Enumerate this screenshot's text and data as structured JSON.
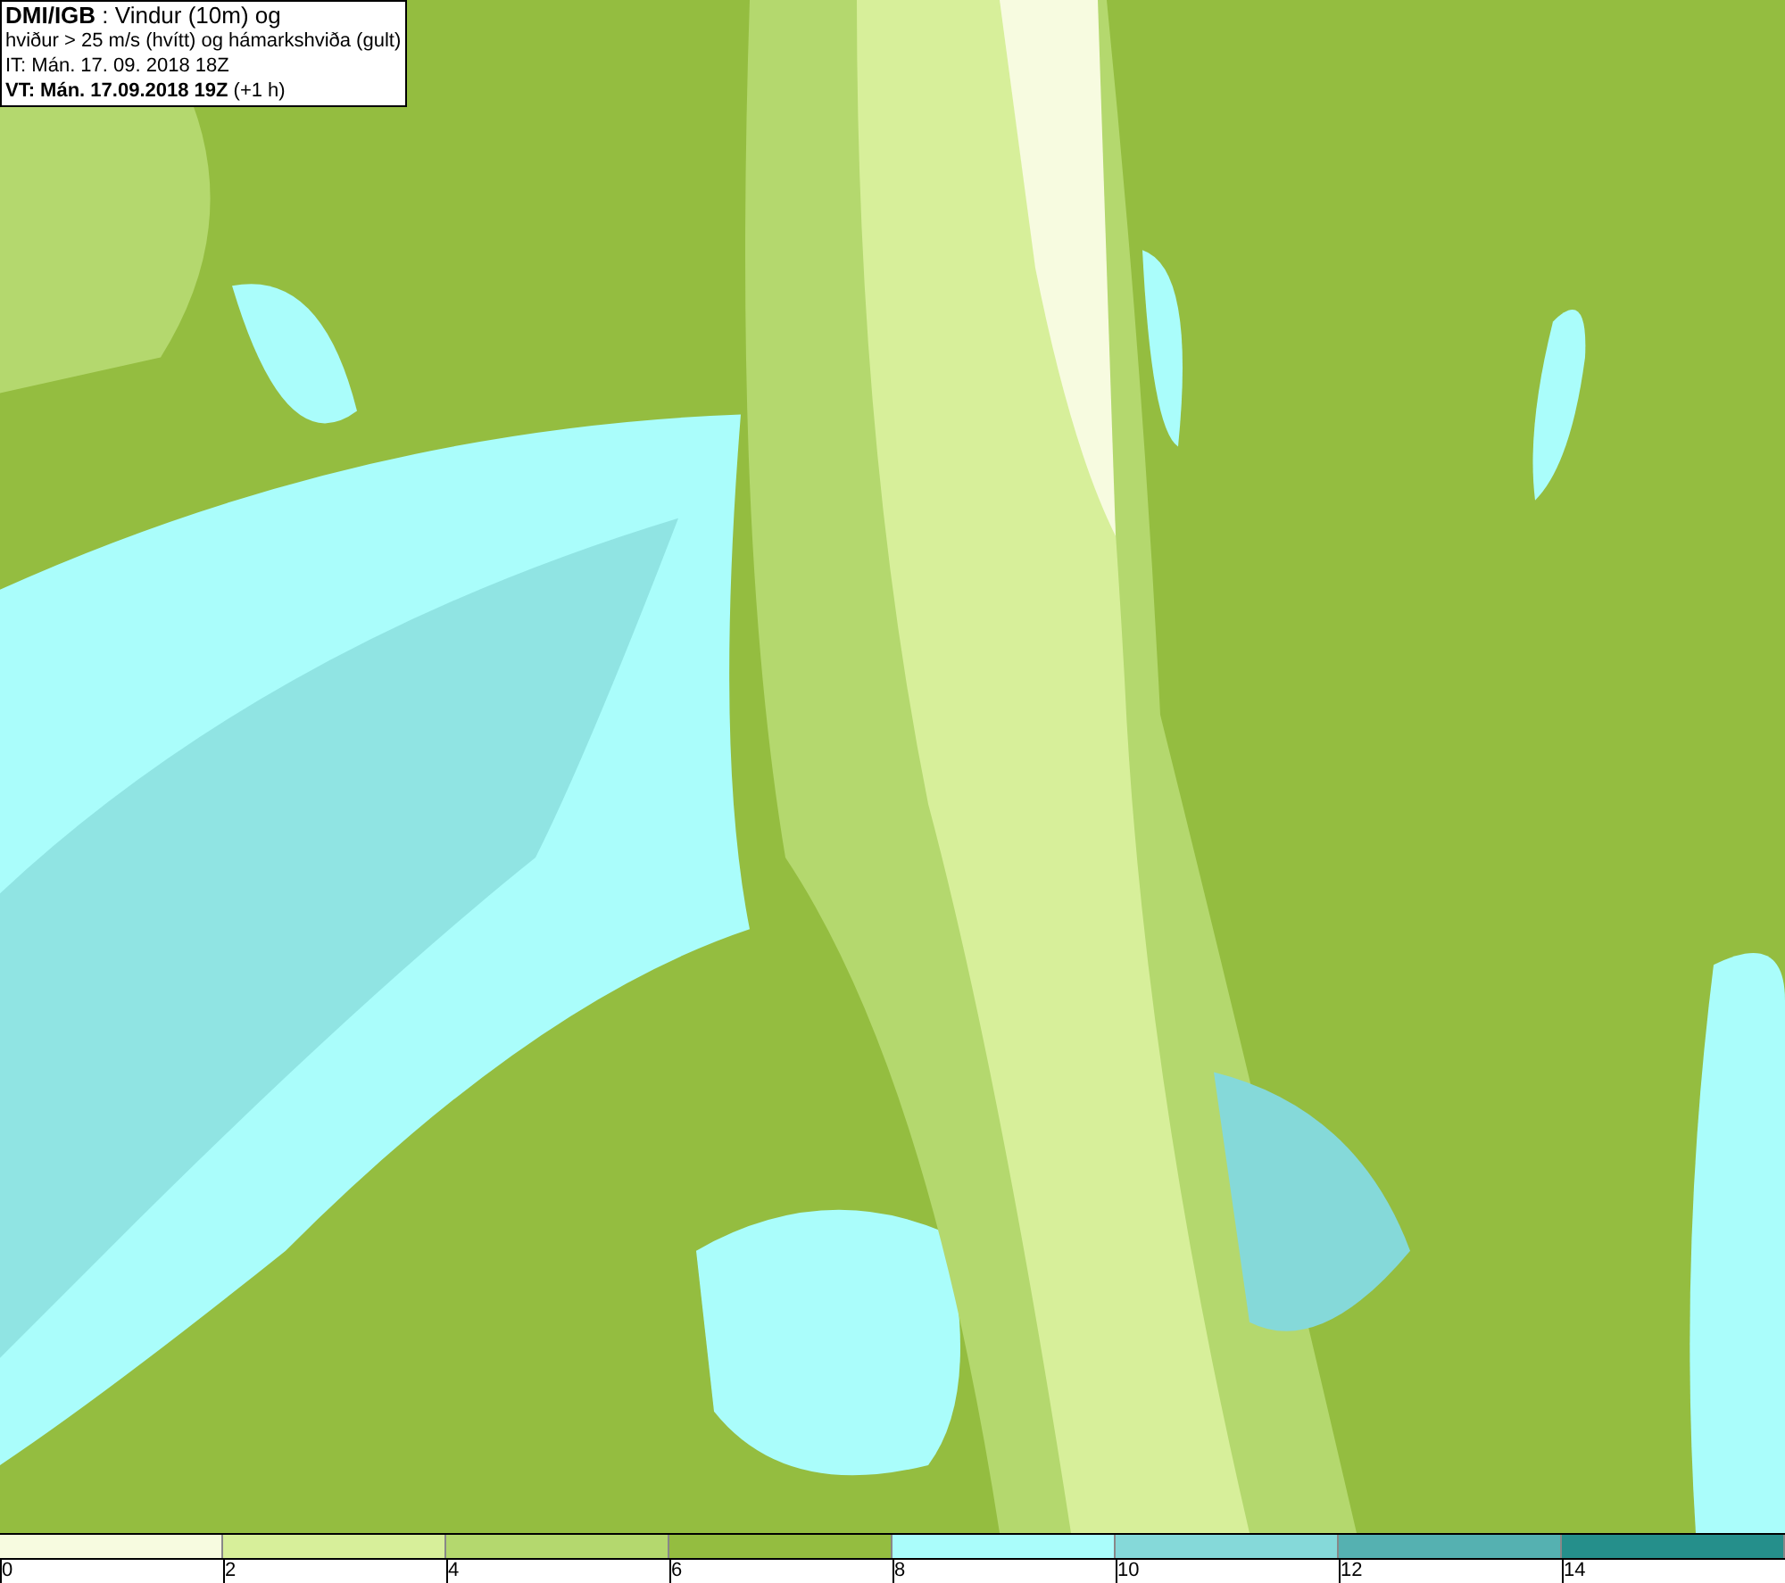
{
  "title_box": {
    "lines": [
      "**DMI/IGB** : Vindur (10m) og",
      "hviður > 25 m/s (hvítt) og hámarkshviða (gult)",
      "IT: Mán. 17. 09. 2018 18Z",
      "**VT: Mán. 17.09.2018 19Z** (+1 h)"
    ]
  },
  "legend": [
    {
      "label": "0",
      "color": "#f7fbe0"
    },
    {
      "label": "2",
      "color": "#d7ef9a"
    },
    {
      "label": "4",
      "color": "#b4d86e"
    },
    {
      "label": "6",
      "color": "#94bd40"
    },
    {
      "label": "8",
      "color": "#aafdfb"
    },
    {
      "label": "10",
      "color": "#85d9d9"
    },
    {
      "label": "12",
      "color": "#55b1b1"
    },
    {
      "label": "14",
      "color": "#258f8b"
    }
  ]
}
